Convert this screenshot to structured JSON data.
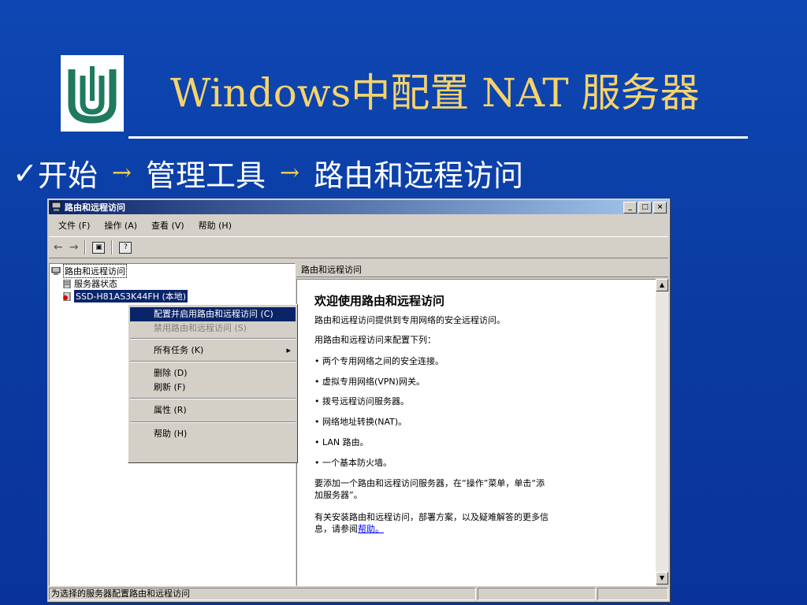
{
  "slide": {
    "title": "Windows中配置 NAT 服务器",
    "subtitle_check": "✓",
    "subtitle_parts": [
      "开始",
      "管理工具",
      "路由和远程访问"
    ],
    "arrow": "→",
    "accent_color": "#f5d36b",
    "background_color": "#0a3a9e"
  },
  "window": {
    "title": "路由和远程访问",
    "buttons": [
      "_",
      "□",
      "×"
    ],
    "menu": [
      "文件 (F)",
      "操作 (A)",
      "查看 (V)",
      "帮助 (H)"
    ],
    "tree": {
      "root": "路由和远程访问",
      "items": [
        "服务器状态",
        "SSD-H81AS3K44FH (本地)"
      ]
    },
    "context_menu": {
      "items": [
        "配置并启用路由和远程访问 (C)",
        "禁用路由和远程访问 (S)",
        "所有任务 (K)",
        "删除 (D)",
        "刷新 (F)",
        "属性 (R)",
        "帮助 (H)"
      ]
    },
    "right_header": "路由和远程访问",
    "right": {
      "heading": "欢迎使用路由和远程访问",
      "lines": [
        "路由和远程访问提供到专用网络的安全远程访问。",
        "用路由和远程访问来配置下列：",
        "• 两个专用网络之间的安全连接。",
        "• 虚拟专用网络(VPN)网关。",
        "• 拨号远程访问服务器。",
        "• 网络地址转换(NAT)。",
        "• LAN 路由。",
        "• 一个基本防火墙。"
      ],
      "para1_line1": "要添加一个路由和远程访问服务器，在“操作”菜单，单击“添",
      "para1_line2": "加服务器”。",
      "para2_line1": "有关安装路由和远程访问，部署方案，以及疑难解答的更多信",
      "para2_line2_prefix": "息，请参阅",
      "para2_link": "帮助。"
    },
    "status_text": "为选择的服务器配置路由和远程访问"
  }
}
